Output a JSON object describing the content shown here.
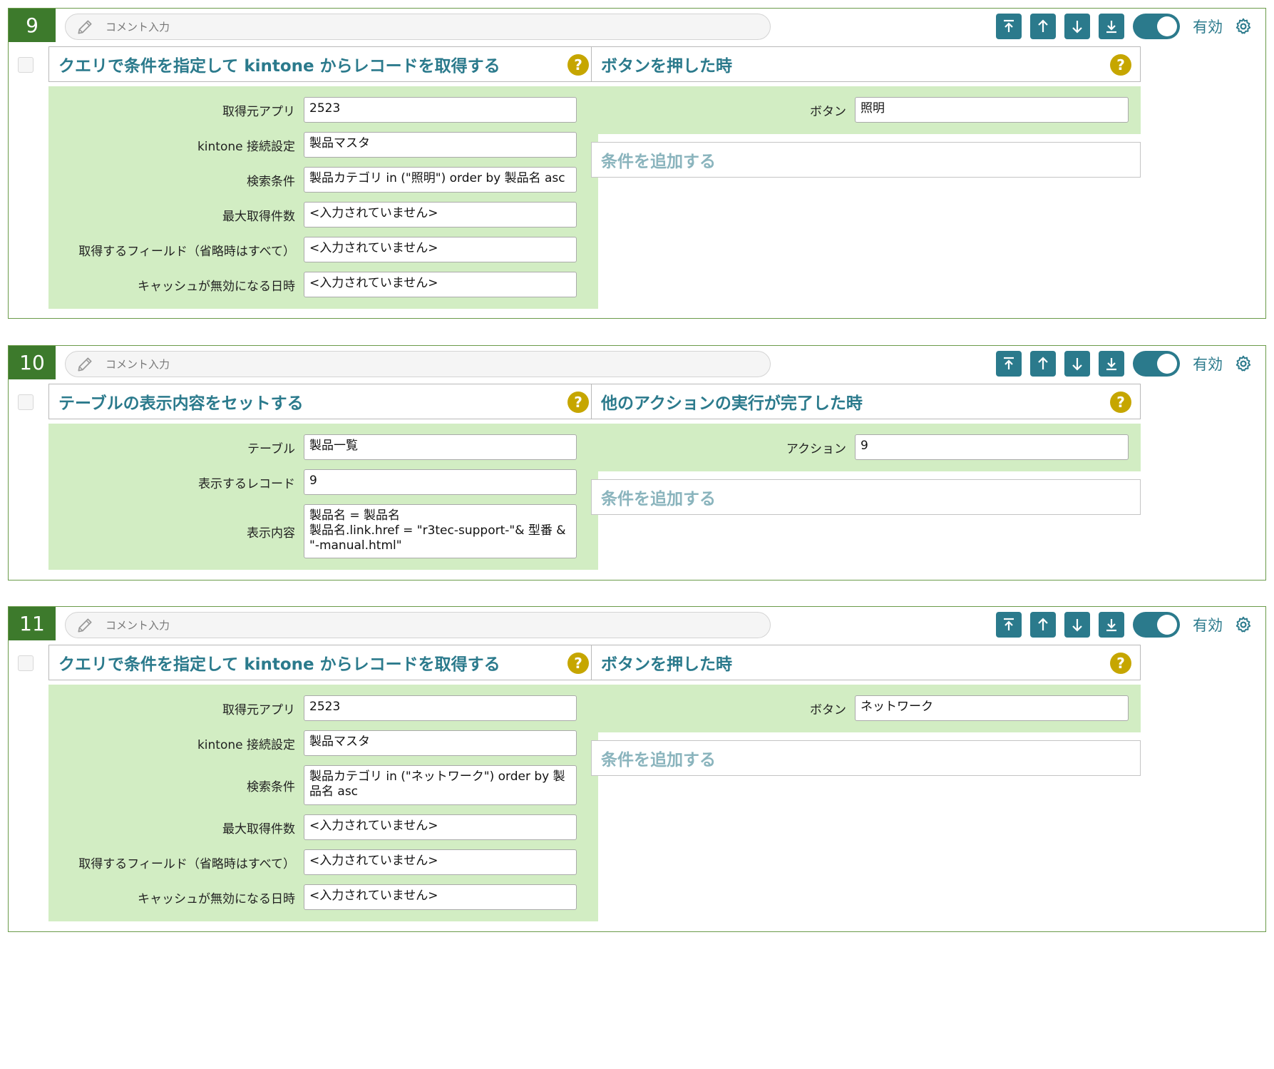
{
  "comment_placeholder": "コメント入力",
  "enabled_label": "有効",
  "help_glyph": "?",
  "add_condition_label": "条件を追加する",
  "toolbar_icons": [
    "move-to-top-icon",
    "move-up-icon",
    "move-down-icon",
    "move-to-bottom-icon"
  ],
  "colors": {
    "accent": "#2b7a8c",
    "number_bg": "#3d7a2c",
    "border": "#6b9b4a",
    "panel_bg": "#d2edc3",
    "help": "#c6a600",
    "add_condition_text": "#8ab4bd"
  },
  "blocks": [
    {
      "number": "9",
      "enabled": true,
      "action": {
        "title": "クエリで条件を指定して kintone からレコードを取得する",
        "fields": [
          {
            "label": "取得元アプリ",
            "value": "2523"
          },
          {
            "label": "kintone 接続設定",
            "value": "製品マスタ"
          },
          {
            "label": "検索条件",
            "value": "製品カテゴリ in (\"照明\") order by 製品名 asc"
          },
          {
            "label": "最大取得件数",
            "value": "<入力されていません>"
          },
          {
            "label": "取得するフィールド（省略時はすべて）",
            "value": "<入力されていません>"
          },
          {
            "label": "キャッシュが無効になる日時",
            "value": "<入力されていません>"
          }
        ]
      },
      "trigger": {
        "title": "ボタンを押した時",
        "fields": [
          {
            "label": "ボタン",
            "value": "照明"
          }
        ]
      }
    },
    {
      "number": "10",
      "enabled": true,
      "action": {
        "title": "テーブルの表示内容をセットする",
        "fields": [
          {
            "label": "テーブル",
            "value": "製品一覧"
          },
          {
            "label": "表示するレコード",
            "value": "9"
          },
          {
            "label": "表示内容",
            "value": "製品名 = 製品名\n製品名.link.href = \"r3tec-support-\"& 型番 & \"-manual.html\""
          }
        ]
      },
      "trigger": {
        "title": "他のアクションの実行が完了した時",
        "fields": [
          {
            "label": "アクション",
            "value": "9"
          }
        ]
      }
    },
    {
      "number": "11",
      "enabled": true,
      "action": {
        "title": "クエリで条件を指定して kintone からレコードを取得する",
        "fields": [
          {
            "label": "取得元アプリ",
            "value": "2523"
          },
          {
            "label": "kintone 接続設定",
            "value": "製品マスタ"
          },
          {
            "label": "検索条件",
            "value": "製品カテゴリ in (\"ネットワーク\") order by 製品名 asc"
          },
          {
            "label": "最大取得件数",
            "value": "<入力されていません>"
          },
          {
            "label": "取得するフィールド（省略時はすべて）",
            "value": "<入力されていません>"
          },
          {
            "label": "キャッシュが無効になる日時",
            "value": "<入力されていません>"
          }
        ]
      },
      "trigger": {
        "title": "ボタンを押した時",
        "fields": [
          {
            "label": "ボタン",
            "value": "ネットワーク"
          }
        ]
      }
    }
  ]
}
